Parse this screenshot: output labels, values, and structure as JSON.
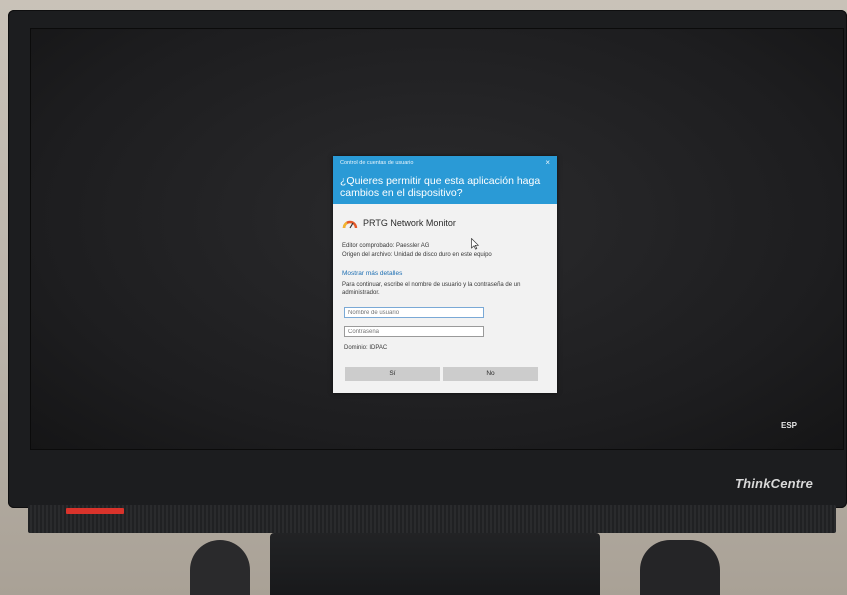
{
  "dialog": {
    "caption": "Control de cuentas de usuario",
    "close_glyph": "×",
    "question": "¿Quieres permitir que esta aplicación haga cambios en el dispositivo?",
    "app_name": "PRTG Network Monitor",
    "app_icon": "gauge-icon",
    "publisher": "Editor comprobado: Paessler AG",
    "origin": "Origen del archivo: Unidad de disco duro en este equipo",
    "details_link": "Mostrar más detalles",
    "instructions": "Para continuar, escribe el nombre de usuario y la contraseña de un administrador.",
    "username_placeholder": "Nombre de usuario",
    "password_placeholder": "Contraseña",
    "domain": "Dominio: IDPAC",
    "yes_label": "Sí",
    "no_label": "No",
    "header_color": "#2a9ad6"
  },
  "taskbar": {
    "language": "ESP"
  },
  "monitor": {
    "brand": "ThinkCentre"
  }
}
